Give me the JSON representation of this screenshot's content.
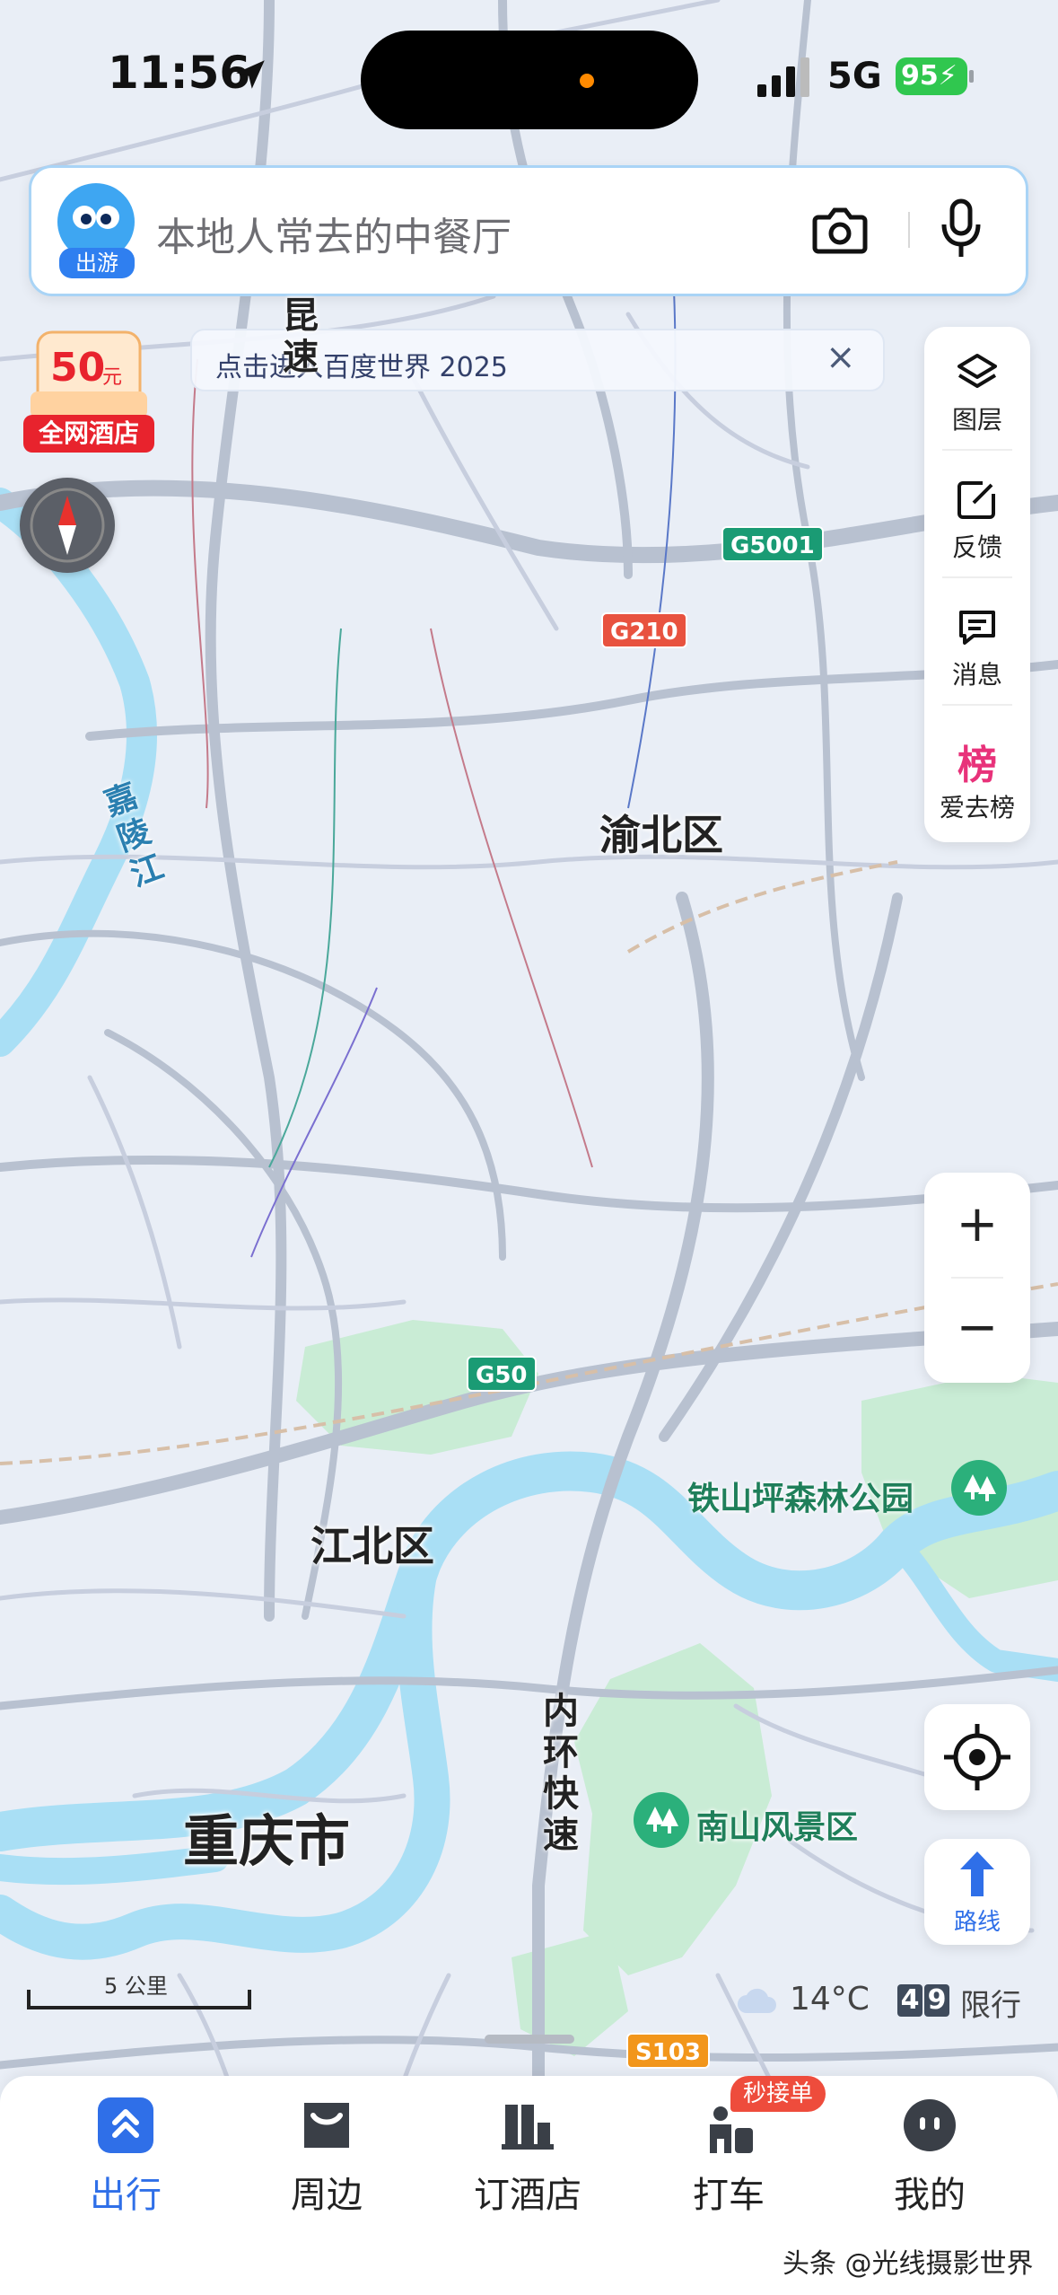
{
  "status_bar": {
    "time": "11:56",
    "network": "5G",
    "battery": "95"
  },
  "search": {
    "badge": "出游",
    "placeholder": "本地人常去的中餐厅"
  },
  "banner": {
    "text": "点击进入百度世界 2025",
    "close": "×"
  },
  "hotel_badge": {
    "amount": "50",
    "unit": "元",
    "label": "全网酒店"
  },
  "side_panel": [
    {
      "label": "图层",
      "icon": "layers-icon"
    },
    {
      "label": "反馈",
      "icon": "feedback-icon"
    },
    {
      "label": "消息",
      "icon": "message-icon"
    },
    {
      "label": "爱去榜",
      "icon": "ranking-icon",
      "glyph": "榜"
    }
  ],
  "zoom": {
    "in": "+",
    "out": "−"
  },
  "route": {
    "label": "路线"
  },
  "map_labels": {
    "district_yubei": "渝北区",
    "district_jiangbei": "江北区",
    "city": "重庆市",
    "river": "嘉陵江",
    "expressway_top": "昆速",
    "inner_ring": "内环快速",
    "poi_tieshanping": "铁山坪森林公园",
    "poi_nanshan": "南山风景区"
  },
  "road_shields": [
    {
      "code": "G5001",
      "color": "#1a9b74"
    },
    {
      "code": "G210",
      "color": "#e8523f"
    },
    {
      "code": "G50",
      "color": "#1a9b74"
    },
    {
      "code": "S103",
      "color": "#f2961b"
    }
  ],
  "scale": {
    "label": "5 公里"
  },
  "weather": {
    "temp": "14°C",
    "plate1": "4",
    "plate2": "9",
    "restrict": "限行"
  },
  "tabs": [
    {
      "label": "出行",
      "icon": "travel-icon",
      "active": true
    },
    {
      "label": "周边",
      "icon": "nearby-icon",
      "active": false
    },
    {
      "label": "订酒店",
      "icon": "hotel-icon",
      "active": false
    },
    {
      "label": "打车",
      "icon": "taxi-icon",
      "active": false,
      "badge": "秒接单"
    },
    {
      "label": "我的",
      "icon": "profile-icon",
      "active": false
    }
  ],
  "watermark": "头条 @光线摄影世界",
  "colors": {
    "accent": "#2f6fe8",
    "water": "#a6dff5",
    "park": "#c7ead3",
    "road": "#b3bccb"
  }
}
